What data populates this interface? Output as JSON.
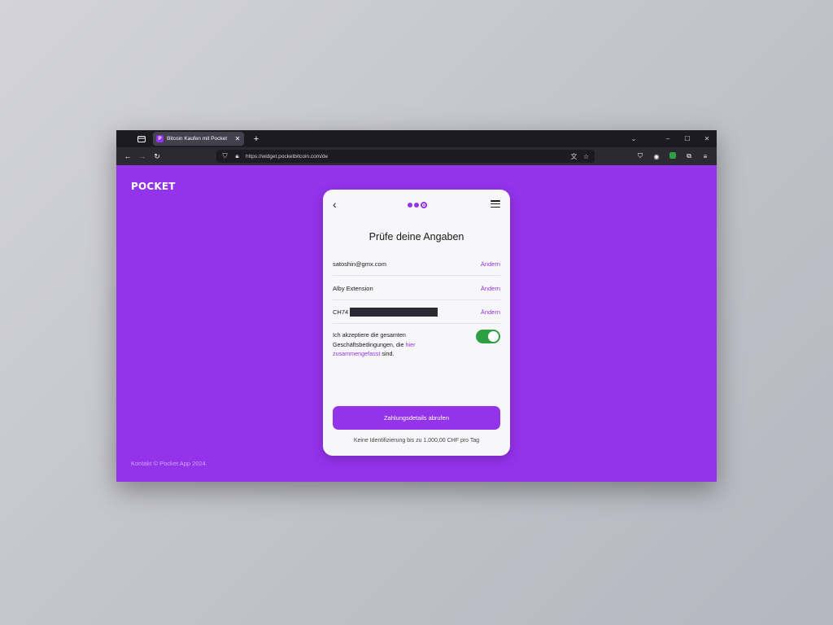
{
  "browser": {
    "tab_title": "Bitcoin Kaufen mit Pocket",
    "favicon_letter": "P",
    "url": "https://widget.pocketbitcoin.com/de"
  },
  "page": {
    "logo": "POCKET",
    "footer": "Kontakt © Pocket App 2024"
  },
  "card": {
    "title": "Prüfe deine Angaben",
    "rows": [
      {
        "value": "satoshin@gmx.com",
        "link": "Ändern"
      },
      {
        "value": "Alby Extension",
        "link": "Ändern"
      },
      {
        "value": "CH74",
        "link": "Ändern"
      }
    ],
    "terms_before": "Ich akzeptiere die gesamten Geschäftsbedingungen, die ",
    "terms_link": "hier zusammengefasst",
    "terms_after": " sind.",
    "toggle_on": true,
    "button_label": "Zahlungsdetails abrufen",
    "limit_note": "Keine Identifizierung bis zu 1.000,00 CHF pro Tag"
  },
  "colors": {
    "brand": "#9333ea",
    "toggle": "#2ea043"
  }
}
